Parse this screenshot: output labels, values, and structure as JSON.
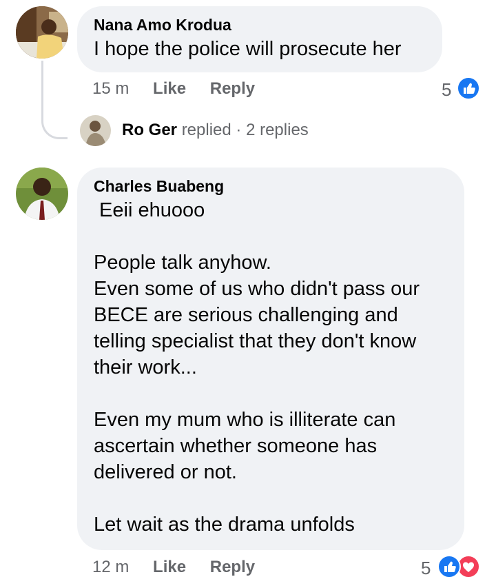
{
  "comments": [
    {
      "author": "Nana Amo Krodua",
      "text": "I hope the police will prosecute her",
      "time": "15 m",
      "like_label": "Like",
      "reply_label": "Reply",
      "reaction_count": "5",
      "reactions": [
        "like-icon"
      ],
      "replies_preview": {
        "author": "Ro Ger",
        "action": "replied",
        "separator": "·",
        "count_label": "2 replies"
      }
    },
    {
      "author": "Charles Buabeng",
      "paragraphs": [
        " Eeii ehuooo",
        "People talk anyhow.",
        "Even some of us who didn't pass our",
        "BECE are serious challenging and",
        "telling specialist that they don't know",
        "their work...",
        "Even my mum who is illiterate can",
        "ascertain whether someone has",
        "delivered or not.",
        "Let wait as the drama unfolds"
      ],
      "time": "12 m",
      "like_label": "Like",
      "reply_label": "Reply",
      "reaction_count": "5",
      "reactions": [
        "like-icon",
        "love-icon"
      ]
    }
  ],
  "colors": {
    "bubble": "#f0f2f5",
    "meta": "#65676b",
    "like_blue": "#1877f2",
    "love_red": "#f33e58"
  }
}
